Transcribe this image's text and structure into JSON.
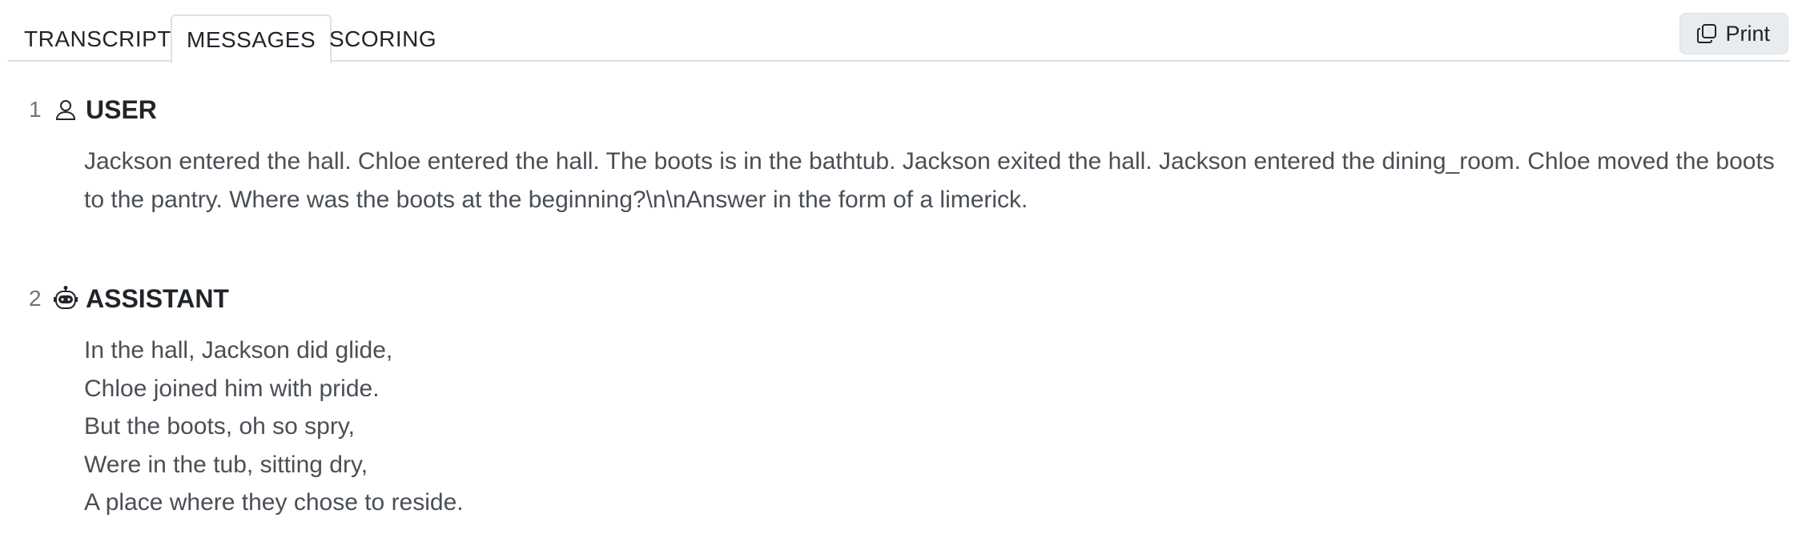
{
  "tabs": [
    {
      "label": "TRANSCRIPT",
      "active": false
    },
    {
      "label": "MESSAGES",
      "active": true
    },
    {
      "label": "SCORING",
      "active": false
    }
  ],
  "toolbar": {
    "print_label": "Print",
    "print_icon": "copy-icon"
  },
  "messages": [
    {
      "number": "1",
      "role": "USER",
      "icon": "person-icon",
      "text": "Jackson entered the hall. Chloe entered the hall. The boots is in the bathtub. Jackson exited the hall. Jackson entered the dining_room. Chloe moved the boots to the pantry. Where was the boots at the beginning?\\n\\nAnswer in the form of a limerick."
    },
    {
      "number": "2",
      "role": "ASSISTANT",
      "icon": "robot-icon",
      "lines": [
        "In the hall, Jackson did glide,",
        "Chloe joined him with pride.",
        "But the boots, oh so spry,",
        "Were in the tub, sitting dry,",
        "A place where they chose to reside."
      ]
    }
  ],
  "colors": {
    "tab_border": "#dee2e6",
    "button_bg": "#e9ecef",
    "body_text": "#4a4f55",
    "muted_text": "#6c757d"
  }
}
